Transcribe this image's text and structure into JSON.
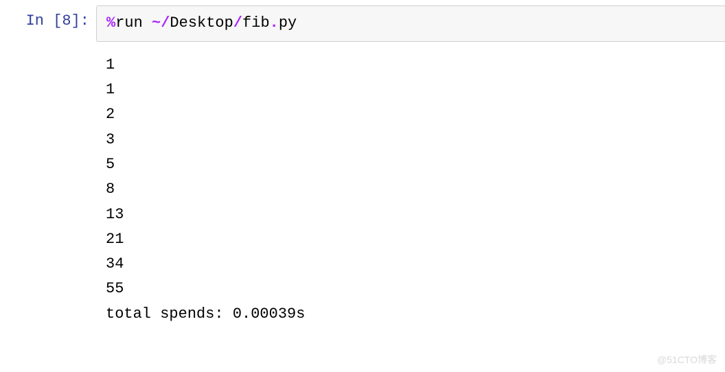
{
  "prompt": {
    "label_in": "In ",
    "open_bracket": "[",
    "number": "8",
    "close_bracket": "]:"
  },
  "code": {
    "magic": "%",
    "cmd": "run ",
    "tilde": "~",
    "path_sep1": "/",
    "dir1": "Desktop",
    "path_sep2": "/",
    "file": "fib",
    "dot": ".",
    "ext": "py"
  },
  "output_lines": [
    "1",
    "1",
    "2",
    "3",
    "5",
    "8",
    "13",
    "21",
    "34",
    "55",
    "total spends: 0.00039s"
  ],
  "watermark": "@51CTO博客"
}
